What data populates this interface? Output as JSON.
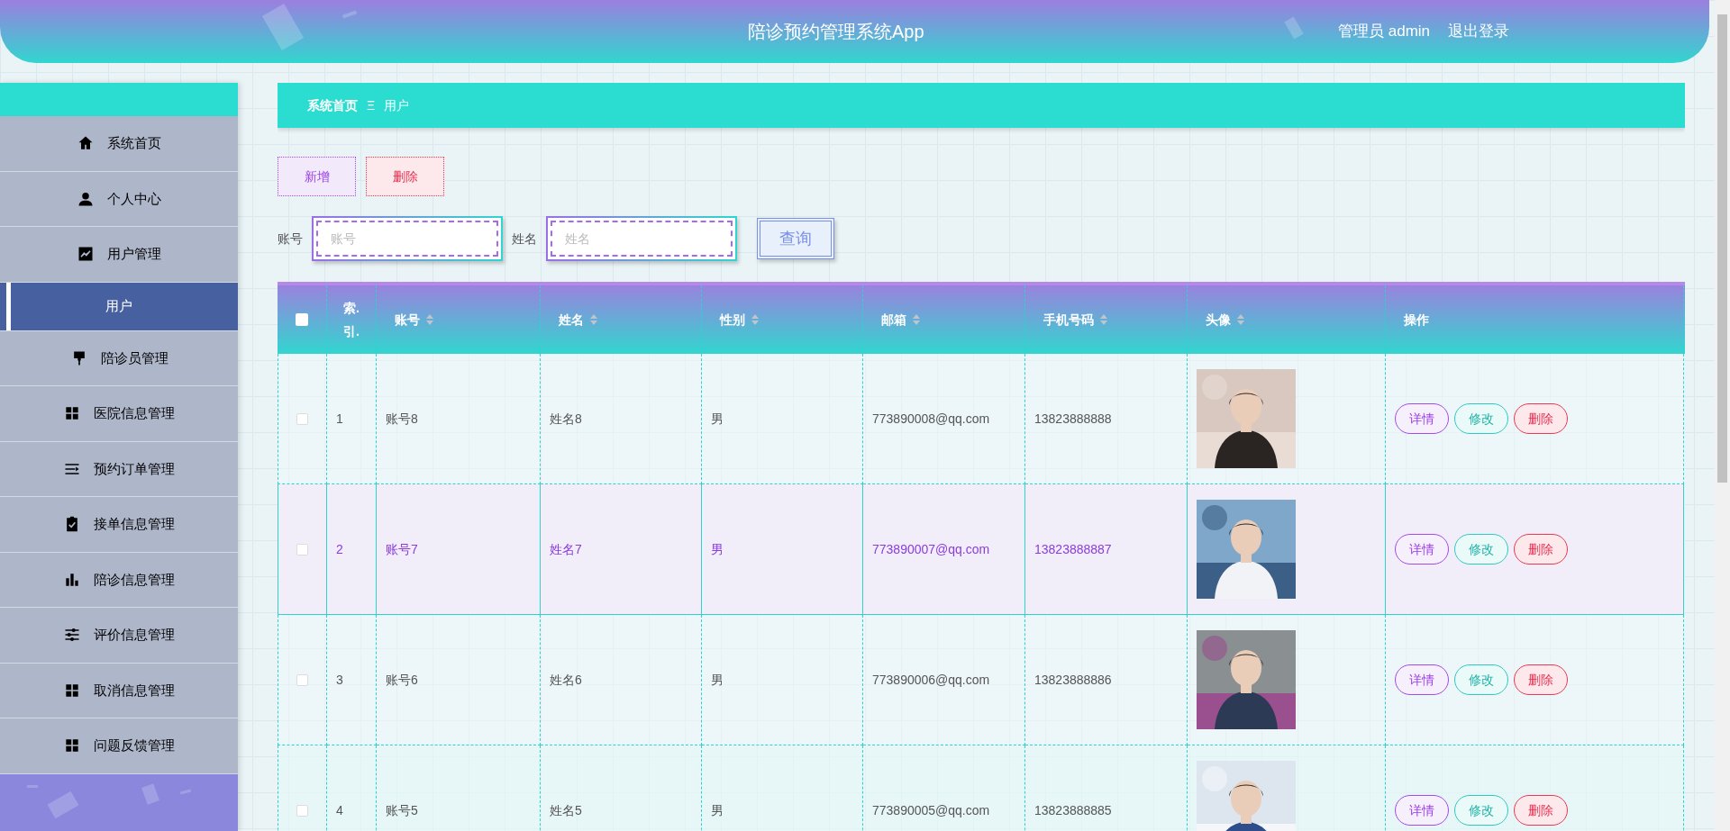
{
  "header": {
    "title": "陪诊预约管理系统App",
    "user": "管理员 admin",
    "logout": "退出登录"
  },
  "sidebar": {
    "items": [
      {
        "label": "系统首页",
        "selected": false
      },
      {
        "label": "个人中心",
        "selected": false
      },
      {
        "label": "用户管理",
        "selected": false,
        "children": [
          {
            "label": "用户",
            "selected": true
          }
        ]
      },
      {
        "label": "陪诊员管理",
        "selected": false
      },
      {
        "label": "医院信息管理",
        "selected": false
      },
      {
        "label": "预约订单管理",
        "selected": false
      },
      {
        "label": "接单信息管理",
        "selected": false
      },
      {
        "label": "陪诊信息管理",
        "selected": false
      },
      {
        "label": "评价信息管理",
        "selected": false
      },
      {
        "label": "取消信息管理",
        "selected": false
      },
      {
        "label": "问题反馈管理",
        "selected": false
      }
    ]
  },
  "breadcrumb": {
    "home": "系统首页",
    "separator": "Ξ",
    "current": "用户"
  },
  "toolbar": {
    "add": "新增",
    "delete": "删除"
  },
  "search": {
    "fields": [
      {
        "label": "账号",
        "placeholder": "账号"
      },
      {
        "label": "姓名",
        "placeholder": "姓名"
      }
    ],
    "button": "查询"
  },
  "table": {
    "select_all": {
      "checked": false
    },
    "columns": [
      {
        "label": "索.引.",
        "sortable": false
      },
      {
        "label": "账号",
        "sortable": true
      },
      {
        "label": "姓名",
        "sortable": true
      },
      {
        "label": "性别",
        "sortable": true
      },
      {
        "label": "邮箱",
        "sortable": true
      },
      {
        "label": "手机号码",
        "sortable": true
      },
      {
        "label": "头像",
        "sortable": true
      },
      {
        "label": "操作",
        "sortable": false
      }
    ],
    "rows": [
      {
        "checked": false,
        "highlighted": false,
        "index": "1",
        "account": "账号8",
        "name": "姓名8",
        "gender": "男",
        "email": "773890008@qq.com",
        "phone": "13823888888",
        "avatar": {
          "kind": "picture"
        },
        "actions": [
          "详情",
          "修改",
          "删除"
        ]
      },
      {
        "checked": false,
        "highlighted": true,
        "index": "2",
        "account": "账号7",
        "name": "姓名7",
        "gender": "男",
        "email": "773890007@qq.com",
        "phone": "13823888887",
        "avatar": {
          "kind": "picture"
        },
        "actions": [
          "详情",
          "修改",
          "删除"
        ]
      },
      {
        "checked": false,
        "highlighted": false,
        "index": "3",
        "account": "账号6",
        "name": "姓名6",
        "gender": "男",
        "email": "773890006@qq.com",
        "phone": "13823888886",
        "avatar": {
          "kind": "picture"
        },
        "actions": [
          "详情",
          "修改",
          "删除"
        ]
      },
      {
        "checked": false,
        "highlighted": false,
        "index": "4",
        "account": "账号5",
        "name": "姓名5",
        "gender": "男",
        "email": "773890005@qq.com",
        "phone": "13823888885",
        "avatar": {
          "kind": "picture"
        },
        "actions": [
          "详情",
          "修改",
          "删除"
        ]
      }
    ]
  }
}
